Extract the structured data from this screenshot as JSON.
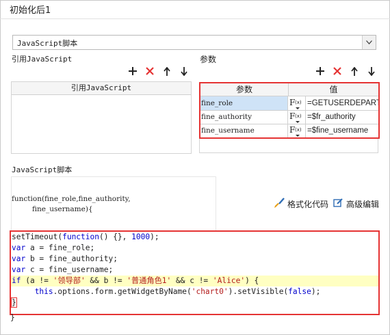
{
  "dialog": {
    "title": "初始化后1"
  },
  "script_type": {
    "selected": "JavaScript脚本"
  },
  "referenced_js": {
    "section_label": "引用JavaScript",
    "column_header": "引用JavaScript"
  },
  "params": {
    "section_label": "参数",
    "col_name": "参数",
    "col_value": "值",
    "rows": [
      {
        "name": "fine_role",
        "value": "=GETUSERDEPARTMENTS("
      },
      {
        "name": "fine_authority",
        "value": "=$fr_authority"
      },
      {
        "name": "fine_username",
        "value": "=$fine_username"
      }
    ]
  },
  "script": {
    "section_label": "JavaScript脚本",
    "signature_line1": "function(fine_role,fine_authority,",
    "signature_line2": "         fine_username){",
    "format_label": "格式化代码",
    "advanced_label": "高级编辑",
    "closing_brace": "}"
  },
  "code": {
    "l1": {
      "a": "setTimeout(",
      "b": "function",
      "c": "() {}, ",
      "d": "1000",
      "e": ");"
    },
    "l2": {
      "a": "var",
      "b": " a = fine_role;"
    },
    "l3": {
      "a": "var",
      "b": " b = fine_authority;"
    },
    "l4": {
      "a": "var",
      "b": " c = fine_username;"
    },
    "l5": {
      "a": "if",
      "b": " (a != ",
      "c": "'领导部'",
      "d": " && b != ",
      "e": "'普通角色1'",
      "f": " && c != ",
      "g": "'Alice'",
      "h": ") {"
    },
    "l6": {
      "indent": "     ",
      "a": "this",
      "b": ".options.form.getWidgetByName(",
      "c": "'chart0'",
      "d": ").setVisible(",
      "e": "false",
      "f": ");"
    },
    "l7": {
      "a": "}"
    }
  },
  "icons": {
    "add": "plus-icon",
    "delete": "cross-icon",
    "up": "arrow-up-icon",
    "down": "arrow-down-icon",
    "fx": "formula-icon",
    "format": "brush-icon",
    "advanced": "edit-icon"
  },
  "colors": {
    "delete": "#e53333",
    "highlight_border": "#e53333",
    "keyword": "#0000cc",
    "string": "#b31b1b",
    "selected_cell": "#cfe3f7"
  }
}
